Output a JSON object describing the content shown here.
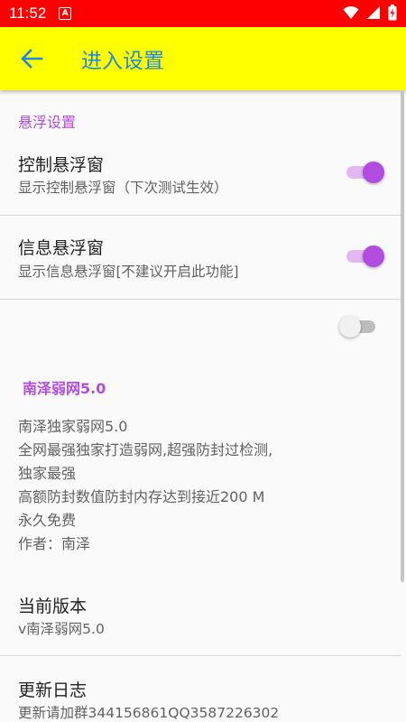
{
  "status_bar": {
    "time": "11:52",
    "notification_badge": "A"
  },
  "app_bar": {
    "title": "进入设置",
    "back_icon": "arrow-left-icon"
  },
  "float_section": {
    "header": "悬浮设置",
    "items": [
      {
        "title": "控制悬浮窗",
        "summary": "显示控制悬浮窗（下次测试生效）",
        "enabled": true
      },
      {
        "title": "信息悬浮窗",
        "summary": "显示信息悬浮窗[不建议开启此功能]",
        "enabled": true
      }
    ],
    "standalone_switch_enabled": false
  },
  "about": {
    "title": "南泽弱网5.0",
    "lines": [
      "南泽独家弱网5.0",
      "全网最强独家打造弱网,超强防封过检测,",
      "独家最强",
      "高额防封数值防封内存达到接近200 M",
      "永久免费",
      "作者：南泽"
    ]
  },
  "version": {
    "title": "当前版本",
    "summary": "v南泽弱网5.0"
  },
  "changelog": {
    "title": "更新日志",
    "summary": "更新请加群344156861QQ3587226302"
  },
  "colors": {
    "status_bar": "#ff0000",
    "app_bar": "#ffff00",
    "title_text": "#1e88e5",
    "accent": "#b24be0"
  }
}
